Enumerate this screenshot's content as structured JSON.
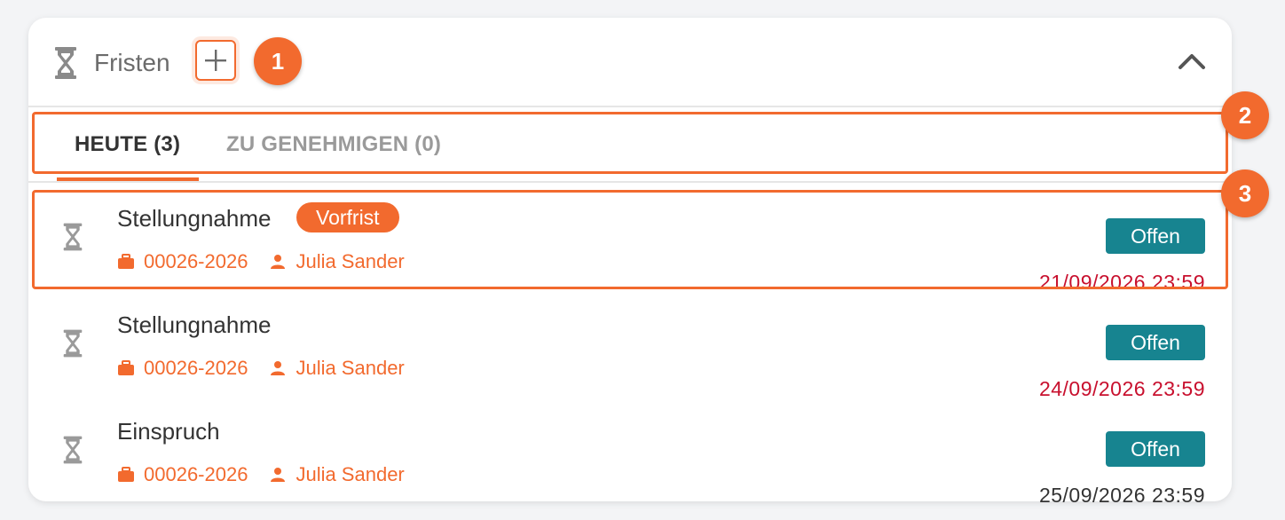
{
  "panel": {
    "title": "Fristen",
    "add_icon": "plus-icon",
    "header_icon": "hourglass-icon",
    "collapse_icon": "chevron-up-icon"
  },
  "tabs": [
    {
      "label": "HEUTE (3)",
      "active": true
    },
    {
      "label": "ZU GENEHMIGEN (0)",
      "active": false
    }
  ],
  "rows": [
    {
      "title": "Stellungnahme",
      "badge": "Vorfrist",
      "case_no": "00026-2026",
      "person": "Julia Sander",
      "status": "Offen",
      "due": "21/09/2026 23:59",
      "due_color": "#c8102e"
    },
    {
      "title": "Stellungnahme",
      "badge": "",
      "case_no": "00026-2026",
      "person": "Julia Sander",
      "status": "Offen",
      "due": "24/09/2026 23:59",
      "due_color": "#c8102e"
    },
    {
      "title": "Einspruch",
      "badge": "",
      "case_no": "00026-2026",
      "person": "Julia Sander",
      "status": "Offen",
      "due": "25/09/2026 23:59",
      "due_color": "#333333"
    }
  ],
  "markers": [
    "1",
    "2",
    "3"
  ],
  "colors": {
    "accent": "#f26a2e",
    "status_teal": "#178490",
    "overdue_red": "#c8102e"
  }
}
